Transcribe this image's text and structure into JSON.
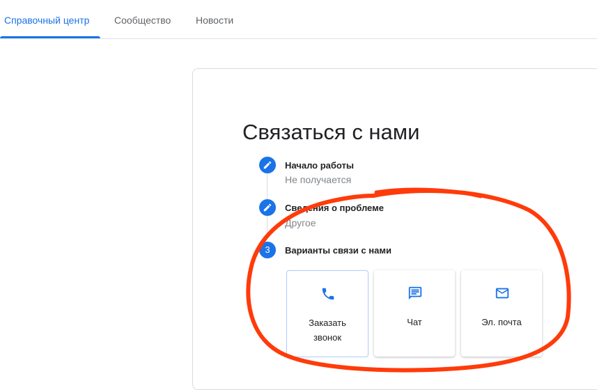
{
  "nav": {
    "tabs": [
      {
        "label": "Справочный центр",
        "active": true
      },
      {
        "label": "Сообщество",
        "active": false
      },
      {
        "label": "Новости",
        "active": false
      }
    ]
  },
  "main": {
    "title": "Связаться с нами",
    "steps": [
      {
        "number": "1",
        "icon": "pencil-icon",
        "title": "Начало работы",
        "value": "Не получается"
      },
      {
        "number": "2",
        "icon": "pencil-icon",
        "title": "Сведения о проблеме",
        "value": "Другое"
      },
      {
        "number": "3",
        "title": "Варианты связи с нами"
      }
    ],
    "contact_options": [
      {
        "icon": "phone-icon",
        "label": "Заказать звонок",
        "selected": true
      },
      {
        "icon": "chat-icon",
        "label": "Чат",
        "selected": false
      },
      {
        "icon": "email-icon",
        "label": "Эл. почта",
        "selected": false
      }
    ]
  },
  "colors": {
    "accent": "#1a73e8",
    "annotation": "#ff3b0a",
    "muted_text": "#80868b"
  }
}
